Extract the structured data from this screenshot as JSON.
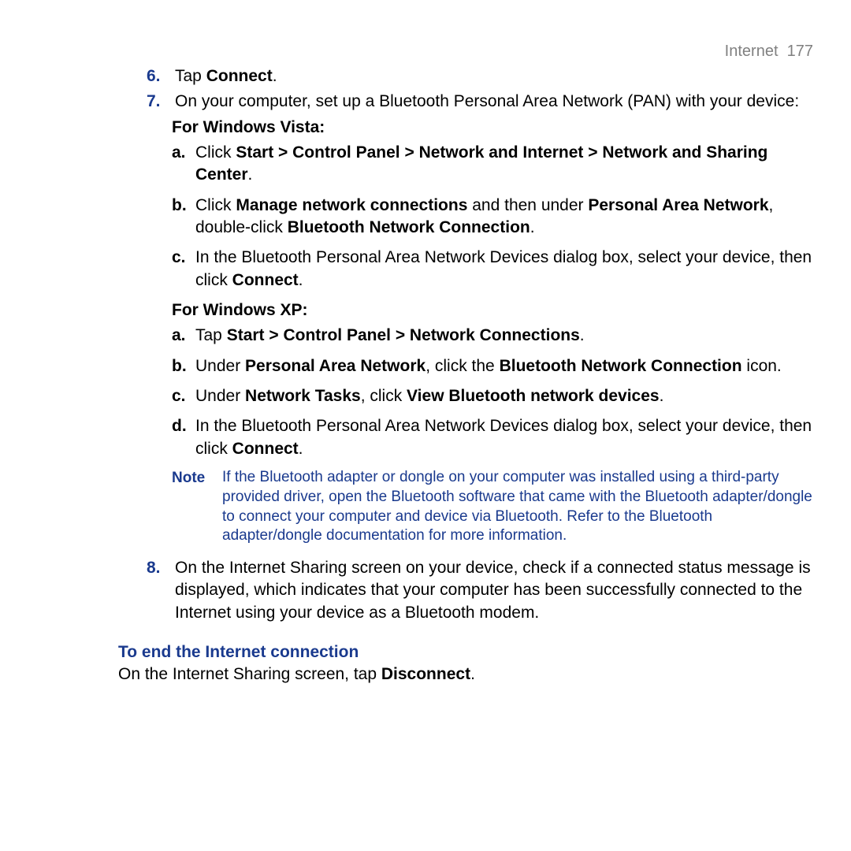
{
  "header": {
    "section": "Internet",
    "page": "177"
  },
  "items": {
    "six": {
      "marker": "6.",
      "pre": "Tap ",
      "bold": "Connect",
      "post": "."
    },
    "seven": {
      "marker": "7.",
      "text": "On your computer, set up a Bluetooth Personal Area Network (PAN) with your device:"
    },
    "vista_label": "For Windows Vista:",
    "vista_a": {
      "marker": "a.",
      "pre": "Click ",
      "bold": "Start > Control Panel > Network and Internet > Network and Sharing Center",
      "post": "."
    },
    "vista_b": {
      "marker": "b.",
      "pre": "Click ",
      "bold1": "Manage network connections",
      "mid1": " and then under ",
      "bold2": "Personal Area Network",
      "mid2": ", double-click ",
      "bold3": "Bluetooth Network Connection",
      "post": "."
    },
    "vista_c": {
      "marker": "c.",
      "pre": "In the Bluetooth Personal Area Network Devices dialog box, select your device, then click ",
      "bold": "Connect",
      "post": "."
    },
    "xp_label": "For Windows XP:",
    "xp_a": {
      "marker": "a.",
      "pre": "Tap ",
      "bold": "Start > Control Panel > Network Connections",
      "post": "."
    },
    "xp_b": {
      "marker": "b.",
      "pre": "Under ",
      "bold1": "Personal Area Network",
      "mid": ", click the ",
      "bold2": "Bluetooth Network Connection",
      "post": " icon."
    },
    "xp_c": {
      "marker": "c.",
      "pre": "Under ",
      "bold1": "Network Tasks",
      "mid": ", click ",
      "bold2": "View Bluetooth network devices",
      "post": "."
    },
    "xp_d": {
      "marker": "d.",
      "pre": "In the Bluetooth Personal Area Network Devices dialog box, select your device, then click ",
      "bold": "Connect",
      "post": "."
    },
    "note": {
      "label": "Note",
      "text": "If the Bluetooth adapter or dongle on your computer was installed using a third-party provided driver, open the Bluetooth software that came with the Bluetooth adapter/dongle to connect your computer and device via Bluetooth. Refer to the Bluetooth adapter/dongle documentation for more information."
    },
    "eight": {
      "marker": "8.",
      "text": "On the Internet Sharing screen on your device, check if a connected status message is displayed, which indicates that your computer has been successfully connected to the Internet using your device as a Bluetooth modem."
    }
  },
  "subheading": "To end the Internet connection",
  "final": {
    "pre": "On the Internet Sharing screen, tap ",
    "bold": "Disconnect",
    "post": "."
  }
}
